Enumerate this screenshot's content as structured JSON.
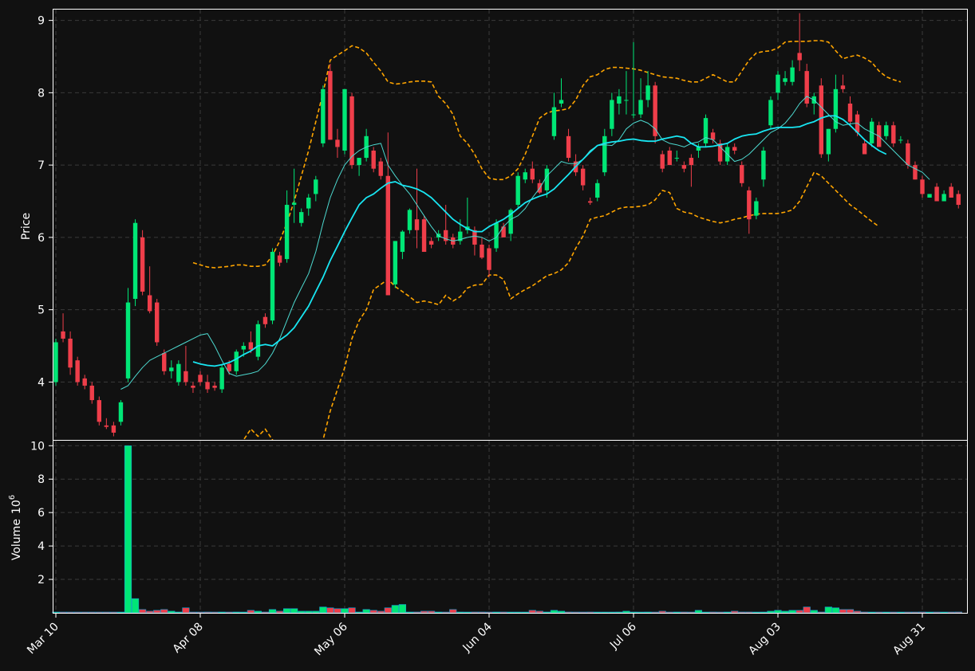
{
  "chart_data": {
    "type": "candlestick",
    "price_panel": {
      "ylabel": "Price",
      "ylim": [
        3.2,
        9.15
      ],
      "yticks": [
        4,
        5,
        6,
        7,
        8,
        9
      ]
    },
    "volume_panel": {
      "ylabel": "Volume",
      "ylabel_exponent": "10",
      "ylabel_exponent_power": "6",
      "ylim": [
        0,
        10.3
      ],
      "yticks": [
        2,
        4,
        6,
        8,
        10
      ]
    },
    "x_tick_labels": [
      "Mar 10",
      "Apr 08",
      "May 06",
      "Jun 04",
      "Jul 06",
      "Aug 03",
      "Aug 31"
    ],
    "x_tick_index": [
      0,
      20,
      40,
      60,
      80,
      100,
      120
    ],
    "colors": {
      "background": "#111111",
      "up": "#00e676",
      "down": "#ef3e4a",
      "ma_fast": "#4dd9d0",
      "ma_slow": "#18e6f2",
      "bollinger": "#ffa500",
      "grid": "#3a3a3a",
      "frame": "#ffffff"
    },
    "ohlc": [
      [
        4.0,
        4.6,
        3.95,
        4.55
      ],
      [
        4.7,
        4.95,
        4.55,
        4.6
      ],
      [
        4.6,
        4.7,
        4.1,
        4.2
      ],
      [
        4.3,
        4.35,
        3.95,
        4.0
      ],
      [
        4.05,
        4.1,
        3.9,
        3.95
      ],
      [
        3.95,
        4.0,
        3.7,
        3.75
      ],
      [
        3.75,
        3.8,
        3.4,
        3.45
      ],
      [
        3.4,
        3.5,
        3.35,
        3.38
      ],
      [
        3.4,
        3.45,
        3.25,
        3.3
      ],
      [
        3.45,
        3.75,
        3.4,
        3.72
      ],
      [
        4.05,
        5.3,
        4.0,
        5.1
      ],
      [
        5.15,
        6.25,
        5.05,
        6.2
      ],
      [
        6.0,
        6.1,
        5.2,
        5.25
      ],
      [
        5.2,
        5.6,
        4.95,
        4.98
      ],
      [
        5.1,
        5.15,
        4.5,
        4.55
      ],
      [
        4.4,
        4.45,
        4.1,
        4.15
      ],
      [
        4.15,
        4.3,
        4.05,
        4.2
      ],
      [
        4.0,
        4.3,
        3.95,
        4.25
      ],
      [
        4.15,
        4.5,
        3.95,
        4.0
      ],
      [
        3.95,
        4.0,
        3.85,
        3.92
      ],
      [
        4.1,
        4.15,
        3.95,
        4.0
      ],
      [
        4.0,
        4.1,
        3.85,
        3.9
      ],
      [
        3.95,
        4.0,
        3.88,
        3.92
      ],
      [
        3.9,
        4.25,
        3.85,
        4.2
      ],
      [
        4.25,
        4.3,
        4.1,
        4.15
      ],
      [
        4.15,
        4.45,
        4.1,
        4.42
      ],
      [
        4.45,
        4.55,
        4.35,
        4.5
      ],
      [
        4.55,
        4.7,
        4.4,
        4.45
      ],
      [
        4.35,
        4.85,
        4.3,
        4.8
      ],
      [
        4.9,
        4.95,
        4.75,
        4.8
      ],
      [
        4.85,
        5.85,
        4.8,
        5.8
      ],
      [
        5.75,
        5.8,
        5.6,
        5.65
      ],
      [
        5.7,
        6.65,
        5.65,
        6.45
      ],
      [
        6.45,
        6.95,
        6.2,
        6.48
      ],
      [
        6.2,
        6.4,
        6.15,
        6.35
      ],
      [
        6.4,
        6.6,
        6.3,
        6.55
      ],
      [
        6.6,
        6.85,
        6.5,
        6.8
      ],
      [
        7.3,
        8.1,
        7.25,
        8.05
      ],
      [
        8.3,
        8.4,
        7.35,
        7.35
      ],
      [
        7.35,
        7.5,
        7.1,
        7.25
      ],
      [
        7.2,
        8.05,
        7.15,
        8.05
      ],
      [
        7.95,
        8.0,
        6.95,
        7.0
      ],
      [
        7.0,
        7.1,
        6.85,
        7.1
      ],
      [
        7.1,
        7.5,
        7.05,
        7.4
      ],
      [
        7.2,
        7.25,
        6.9,
        6.95
      ],
      [
        7.05,
        7.1,
        6.8,
        6.85
      ],
      [
        6.85,
        7.45,
        5.25,
        5.2
      ],
      [
        5.35,
        5.95,
        5.3,
        5.95
      ],
      [
        5.8,
        6.1,
        5.7,
        6.08
      ],
      [
        6.1,
        6.4,
        6.05,
        6.38
      ],
      [
        6.25,
        6.95,
        5.85,
        6.1
      ],
      [
        6.25,
        6.3,
        5.8,
        5.8
      ],
      [
        5.95,
        6.0,
        5.85,
        5.9
      ],
      [
        6.0,
        6.1,
        5.95,
        6.05
      ],
      [
        6.1,
        6.45,
        5.9,
        5.95
      ],
      [
        6.0,
        6.05,
        5.85,
        5.9
      ],
      [
        5.95,
        6.25,
        5.9,
        6.08
      ],
      [
        6.1,
        6.55,
        6.05,
        6.15
      ],
      [
        6.1,
        6.15,
        5.75,
        5.9
      ],
      [
        5.9,
        6.0,
        5.7,
        5.72
      ],
      [
        5.85,
        5.9,
        5.45,
        5.55
      ],
      [
        5.85,
        6.25,
        5.8,
        6.2
      ],
      [
        6.15,
        6.2,
        6.0,
        6.0
      ],
      [
        6.05,
        6.4,
        5.95,
        6.38
      ],
      [
        6.45,
        6.9,
        6.4,
        6.85
      ],
      [
        6.8,
        6.95,
        6.75,
        6.9
      ],
      [
        6.95,
        7.05,
        6.75,
        6.8
      ],
      [
        6.75,
        6.8,
        6.6,
        6.62
      ],
      [
        6.65,
        7.0,
        6.55,
        6.95
      ],
      [
        7.4,
        8.0,
        7.35,
        7.8
      ],
      [
        7.85,
        8.2,
        7.8,
        7.9
      ],
      [
        7.4,
        7.5,
        7.05,
        7.1
      ],
      [
        7.05,
        7.15,
        6.85,
        6.9
      ],
      [
        6.95,
        7.0,
        6.65,
        6.72
      ],
      [
        6.5,
        6.55,
        6.45,
        6.48
      ],
      [
        6.55,
        6.8,
        6.5,
        6.75
      ],
      [
        6.9,
        7.5,
        6.85,
        7.4
      ],
      [
        7.5,
        8.0,
        7.4,
        7.9
      ],
      [
        7.85,
        8.05,
        7.7,
        7.95
      ],
      [
        7.9,
        8.3,
        7.7,
        7.9
      ],
      [
        7.7,
        8.7,
        7.65,
        7.7
      ],
      [
        7.7,
        8.2,
        7.65,
        7.9
      ],
      [
        7.9,
        8.3,
        7.8,
        8.1
      ],
      [
        8.1,
        8.15,
        7.3,
        7.4
      ],
      [
        7.15,
        7.2,
        6.9,
        6.95
      ],
      [
        7.2,
        7.25,
        7.0,
        7.0
      ],
      [
        7.1,
        7.2,
        7.05,
        7.1
      ],
      [
        7.0,
        7.05,
        6.9,
        6.95
      ],
      [
        7.1,
        7.15,
        6.7,
        7.0
      ],
      [
        7.2,
        7.3,
        7.1,
        7.25
      ],
      [
        7.3,
        7.7,
        7.25,
        7.65
      ],
      [
        7.45,
        7.5,
        7.3,
        7.35
      ],
      [
        7.3,
        7.35,
        7.0,
        7.05
      ],
      [
        7.05,
        7.3,
        7.0,
        7.25
      ],
      [
        7.25,
        7.3,
        7.15,
        7.2
      ],
      [
        7.0,
        7.05,
        6.7,
        6.75
      ],
      [
        6.65,
        6.7,
        6.05,
        6.25
      ],
      [
        6.3,
        6.55,
        6.25,
        6.5
      ],
      [
        6.8,
        7.25,
        6.7,
        7.2
      ],
      [
        7.55,
        7.95,
        7.5,
        7.9
      ],
      [
        8.0,
        8.3,
        7.9,
        8.25
      ],
      [
        8.15,
        8.3,
        8.1,
        8.2
      ],
      [
        8.15,
        8.45,
        8.1,
        8.35
      ],
      [
        8.55,
        9.1,
        8.3,
        8.45
      ],
      [
        8.3,
        8.4,
        7.8,
        7.85
      ],
      [
        7.85,
        8.0,
        7.7,
        7.95
      ],
      [
        8.1,
        8.2,
        7.1,
        7.15
      ],
      [
        7.15,
        7.5,
        7.05,
        7.5
      ],
      [
        7.5,
        8.25,
        7.45,
        8.05
      ],
      [
        8.1,
        8.25,
        8.0,
        8.05
      ],
      [
        7.85,
        7.95,
        7.55,
        7.6
      ],
      [
        7.7,
        7.75,
        7.4,
        7.45
      ],
      [
        7.3,
        7.35,
        7.15,
        7.15
      ],
      [
        7.3,
        7.65,
        7.25,
        7.6
      ],
      [
        7.55,
        7.6,
        7.25,
        7.25
      ],
      [
        7.4,
        7.6,
        7.35,
        7.55
      ],
      [
        7.55,
        7.6,
        7.25,
        7.3
      ],
      [
        7.35,
        7.4,
        7.3,
        7.35
      ],
      [
        7.3,
        7.35,
        6.95,
        7.0
      ],
      [
        7.0,
        7.05,
        6.8,
        6.8
      ],
      [
        6.8,
        6.85,
        6.55,
        6.6
      ],
      [
        6.55,
        6.6,
        6.55,
        6.6
      ],
      [
        6.7,
        6.75,
        6.5,
        6.5
      ],
      [
        6.5,
        6.65,
        6.5,
        6.6
      ],
      [
        6.7,
        6.75,
        6.55,
        6.55
      ],
      [
        6.6,
        6.65,
        6.4,
        6.45
      ]
    ],
    "ma_fast": [
      null,
      null,
      null,
      null,
      null,
      null,
      null,
      null,
      null,
      3.9,
      3.95,
      4.08,
      4.2,
      4.3,
      4.35,
      4.4,
      4.45,
      4.5,
      4.55,
      4.6,
      4.65,
      4.67,
      4.5,
      4.3,
      4.12,
      4.08,
      4.1,
      4.12,
      4.15,
      4.25,
      4.4,
      4.6,
      4.85,
      5.1,
      5.3,
      5.5,
      5.8,
      6.2,
      6.55,
      6.8,
      7.0,
      7.12,
      7.2,
      7.25,
      7.28,
      7.3,
      7.0,
      6.85,
      6.72,
      6.6,
      6.45,
      6.3,
      6.15,
      6.02,
      5.98,
      5.95,
      5.97,
      6.0,
      6.02,
      6.0,
      5.95,
      6.0,
      6.15,
      6.25,
      6.3,
      6.4,
      6.55,
      6.68,
      6.85,
      6.95,
      7.05,
      7.02,
      7.02,
      7.08,
      7.2,
      7.27,
      7.28,
      7.27,
      7.35,
      7.5,
      7.58,
      7.62,
      7.58,
      7.5,
      7.35,
      7.3,
      7.28,
      7.25,
      7.3,
      7.32,
      7.38,
      7.35,
      7.25,
      7.15,
      7.05,
      7.08,
      7.15,
      7.25,
      7.35,
      7.45,
      7.5,
      7.58,
      7.7,
      7.85,
      7.95,
      7.9,
      7.8,
      7.7,
      7.6,
      7.55,
      7.57,
      7.58,
      7.5,
      7.45,
      7.4,
      7.3,
      7.2,
      7.1,
      7.0,
      6.95,
      6.9,
      6.8
    ],
    "ma_slow": [
      null,
      null,
      null,
      null,
      null,
      null,
      null,
      null,
      null,
      null,
      null,
      null,
      null,
      null,
      null,
      null,
      null,
      null,
      null,
      4.28,
      4.25,
      4.23,
      4.22,
      4.24,
      4.27,
      4.32,
      4.38,
      4.43,
      4.5,
      4.52,
      4.5,
      4.58,
      4.65,
      4.75,
      4.9,
      5.05,
      5.25,
      5.45,
      5.68,
      5.88,
      6.08,
      6.27,
      6.45,
      6.55,
      6.6,
      6.68,
      6.75,
      6.77,
      6.72,
      6.7,
      6.67,
      6.62,
      6.55,
      6.45,
      6.35,
      6.25,
      6.18,
      6.12,
      6.08,
      6.08,
      6.15,
      6.2,
      6.25,
      6.32,
      6.4,
      6.48,
      6.53,
      6.57,
      6.6,
      6.67,
      6.77,
      6.87,
      6.98,
      7.08,
      7.18,
      7.27,
      7.3,
      7.32,
      7.33,
      7.35,
      7.36,
      7.34,
      7.33,
      7.33,
      7.36,
      7.38,
      7.4,
      7.38,
      7.3,
      7.25,
      7.25,
      7.26,
      7.28,
      7.3,
      7.36,
      7.4,
      7.42,
      7.43,
      7.47,
      7.5,
      7.52,
      7.52,
      7.52,
      7.53,
      7.57,
      7.6,
      7.65,
      7.68,
      7.68,
      7.63,
      7.55,
      7.45,
      7.35,
      7.27,
      7.2,
      7.15
    ],
    "bb_upper": [
      null,
      null,
      null,
      null,
      null,
      null,
      null,
      null,
      null,
      null,
      null,
      null,
      null,
      null,
      null,
      null,
      null,
      null,
      null,
      5.65,
      5.62,
      5.59,
      5.58,
      5.59,
      5.6,
      5.62,
      5.62,
      5.6,
      5.6,
      5.62,
      5.75,
      5.95,
      6.2,
      6.5,
      6.85,
      7.2,
      7.6,
      8.0,
      8.45,
      8.52,
      8.58,
      8.65,
      8.62,
      8.55,
      8.42,
      8.3,
      8.15,
      8.12,
      8.13,
      8.15,
      8.16,
      8.16,
      8.15,
      7.95,
      7.85,
      7.7,
      7.4,
      7.3,
      7.15,
      6.95,
      6.82,
      6.8,
      6.8,
      6.85,
      6.95,
      7.15,
      7.4,
      7.65,
      7.72,
      7.75,
      7.76,
      7.78,
      7.9,
      8.1,
      8.22,
      8.25,
      8.32,
      8.35,
      8.35,
      8.34,
      8.33,
      8.31,
      8.28,
      8.25,
      8.22,
      8.21,
      8.2,
      8.17,
      8.15,
      8.15,
      8.2,
      8.25,
      8.2,
      8.15,
      8.15,
      8.3,
      8.45,
      8.55,
      8.57,
      8.58,
      8.62,
      8.7,
      8.71,
      8.71,
      8.71,
      8.72,
      8.72,
      8.7,
      8.58,
      8.47,
      8.5,
      8.52,
      8.48,
      8.42,
      8.3,
      8.22,
      8.18,
      8.15
    ],
    "bb_lower": [
      null,
      null,
      null,
      null,
      null,
      null,
      null,
      null,
      null,
      null,
      null,
      null,
      null,
      null,
      null,
      null,
      null,
      null,
      null,
      2.9,
      2.88,
      2.86,
      2.86,
      2.88,
      2.9,
      3.05,
      3.2,
      3.35,
      3.25,
      3.35,
      3.2,
      3.1,
      2.95,
      2.9,
      2.8,
      2.75,
      2.85,
      3.2,
      3.6,
      3.9,
      4.2,
      4.6,
      4.85,
      5.0,
      5.28,
      5.35,
      5.42,
      5.32,
      5.25,
      5.18,
      5.1,
      5.12,
      5.1,
      5.07,
      5.2,
      5.12,
      5.18,
      5.3,
      5.34,
      5.35,
      5.48,
      5.48,
      5.42,
      5.15,
      5.22,
      5.28,
      5.33,
      5.4,
      5.47,
      5.5,
      5.55,
      5.65,
      5.85,
      6.02,
      6.25,
      6.28,
      6.3,
      6.35,
      6.4,
      6.42,
      6.42,
      6.43,
      6.45,
      6.52,
      6.65,
      6.62,
      6.4,
      6.35,
      6.33,
      6.28,
      6.25,
      6.22,
      6.2,
      6.22,
      6.25,
      6.27,
      6.3,
      6.32,
      6.33,
      6.33,
      6.33,
      6.35,
      6.38,
      6.5,
      6.7,
      6.9,
      6.85,
      6.75,
      6.65,
      6.55,
      6.45,
      6.38,
      6.3,
      6.22,
      6.15
    ],
    "volume": [
      0.03,
      0.02,
      0.0,
      0.0,
      0.0,
      0.0,
      0.0,
      0.0,
      0.0,
      0.0,
      10.0,
      0.85,
      0.2,
      0.1,
      0.15,
      0.2,
      0.1,
      0.05,
      0.3,
      0.03,
      0.02,
      0.05,
      0.0,
      0.05,
      0.02,
      0.05,
      0.03,
      0.15,
      0.1,
      0.05,
      0.2,
      0.1,
      0.25,
      0.25,
      0.1,
      0.1,
      0.1,
      0.35,
      0.3,
      0.25,
      0.25,
      0.3,
      0.05,
      0.2,
      0.15,
      0.1,
      0.3,
      0.45,
      0.5,
      0.05,
      0.05,
      0.1,
      0.1,
      0.05,
      0.0,
      0.2,
      0.05,
      0.0,
      0.05,
      0.05,
      0.03,
      0.05,
      0.05,
      0.02,
      0.03,
      0.02,
      0.15,
      0.1,
      0.05,
      0.15,
      0.1,
      0.05,
      0.02,
      0.0,
      0.05,
      0.02,
      0.03,
      0.02,
      0.05,
      0.1,
      0.05,
      0.0,
      0.05,
      0.0,
      0.1,
      0.0,
      0.05,
      0.05,
      0.03,
      0.15,
      0.02,
      0.05,
      0.0,
      0.05,
      0.1,
      0.05,
      0.05,
      0.03,
      0.05,
      0.1,
      0.15,
      0.1,
      0.15,
      0.15,
      0.35,
      0.15,
      0.05,
      0.35,
      0.3,
      0.2,
      0.2,
      0.1,
      0.05,
      0.03,
      0.02,
      0.03,
      0.02,
      0.02,
      0.0,
      0.02,
      0.05,
      0.03,
      0.02,
      0.0,
      0.02,
      0.05
    ]
  }
}
